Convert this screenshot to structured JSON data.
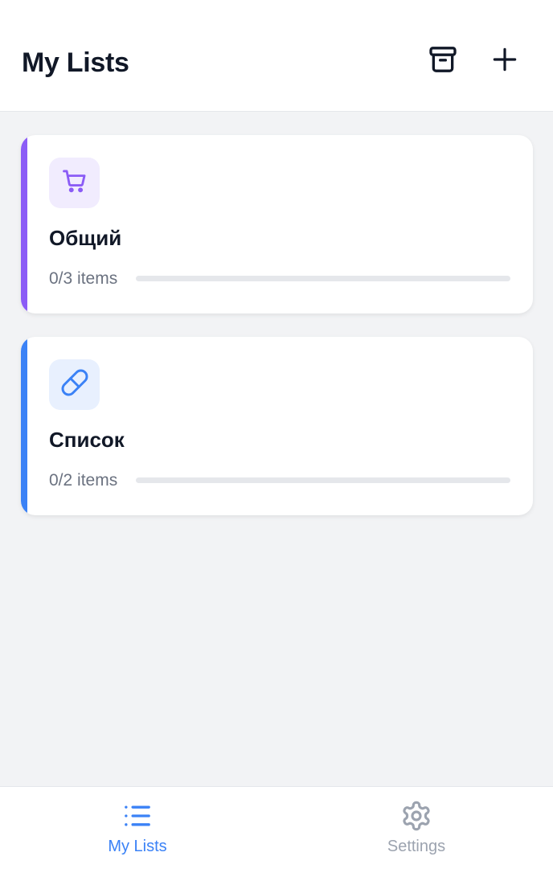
{
  "header": {
    "title": "My Lists",
    "actions": [
      {
        "name": "archive",
        "icon": "archive-icon"
      },
      {
        "name": "add",
        "icon": "plus-icon"
      }
    ]
  },
  "lists": [
    {
      "title": "Общий",
      "count_text": "0/3 items",
      "progress": 0,
      "icon": "shopping-cart-icon",
      "accent_color": "#8b5cf6",
      "icon_bg": "#f1ecfe"
    },
    {
      "title": "Список",
      "count_text": "0/2 items",
      "progress": 0,
      "icon": "pill-icon",
      "accent_color": "#3b82f6",
      "icon_bg": "#e8f0fe"
    }
  ],
  "nav": {
    "items": [
      {
        "label": "My Lists",
        "icon": "list-icon",
        "active": true
      },
      {
        "label": "Settings",
        "icon": "gear-icon",
        "active": false
      }
    ]
  },
  "colors": {
    "active": "#3b82f6",
    "inactive": "#9ca3af",
    "background": "#f2f3f5"
  }
}
